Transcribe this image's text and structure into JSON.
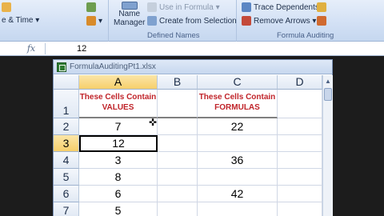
{
  "ribbon": {
    "left_partial": [
      "e & Time ▾",
      "▾"
    ],
    "name_manager": [
      "Name",
      "Manager"
    ],
    "use_in_formula": "Use in Formula ▾",
    "create_from_selection": "Create from Selection",
    "defined_names_label": "Defined Names",
    "trace_dependents": "Trace Dependents",
    "remove_arrows": "Remove Arrows ▾",
    "formula_auditing_label": "Formula Auditing"
  },
  "formula_bar": {
    "fx": "fx",
    "value": "12"
  },
  "workbook": {
    "title": "FormulaAuditingPt1.xlsx"
  },
  "columns": [
    "A",
    "B",
    "C",
    "D"
  ],
  "rows": [
    {
      "num": "1",
      "A": "These Cells Contain\nVALUES",
      "B": "",
      "C": "These Cells Contain\nFORMULAS",
      "D": ""
    },
    {
      "num": "2",
      "A": "7",
      "B": "",
      "C": "22",
      "D": ""
    },
    {
      "num": "3",
      "A": "12",
      "B": "",
      "C": "",
      "D": ""
    },
    {
      "num": "4",
      "A": "3",
      "B": "",
      "C": "36",
      "D": ""
    },
    {
      "num": "5",
      "A": "8",
      "B": "",
      "C": "",
      "D": ""
    },
    {
      "num": "6",
      "A": "6",
      "B": "",
      "C": "42",
      "D": ""
    },
    {
      "num": "7",
      "A": "5",
      "B": "",
      "C": "",
      "D": ""
    }
  ],
  "colors": {
    "header_text": "#c0242a",
    "selection": "#f6cf6b"
  }
}
